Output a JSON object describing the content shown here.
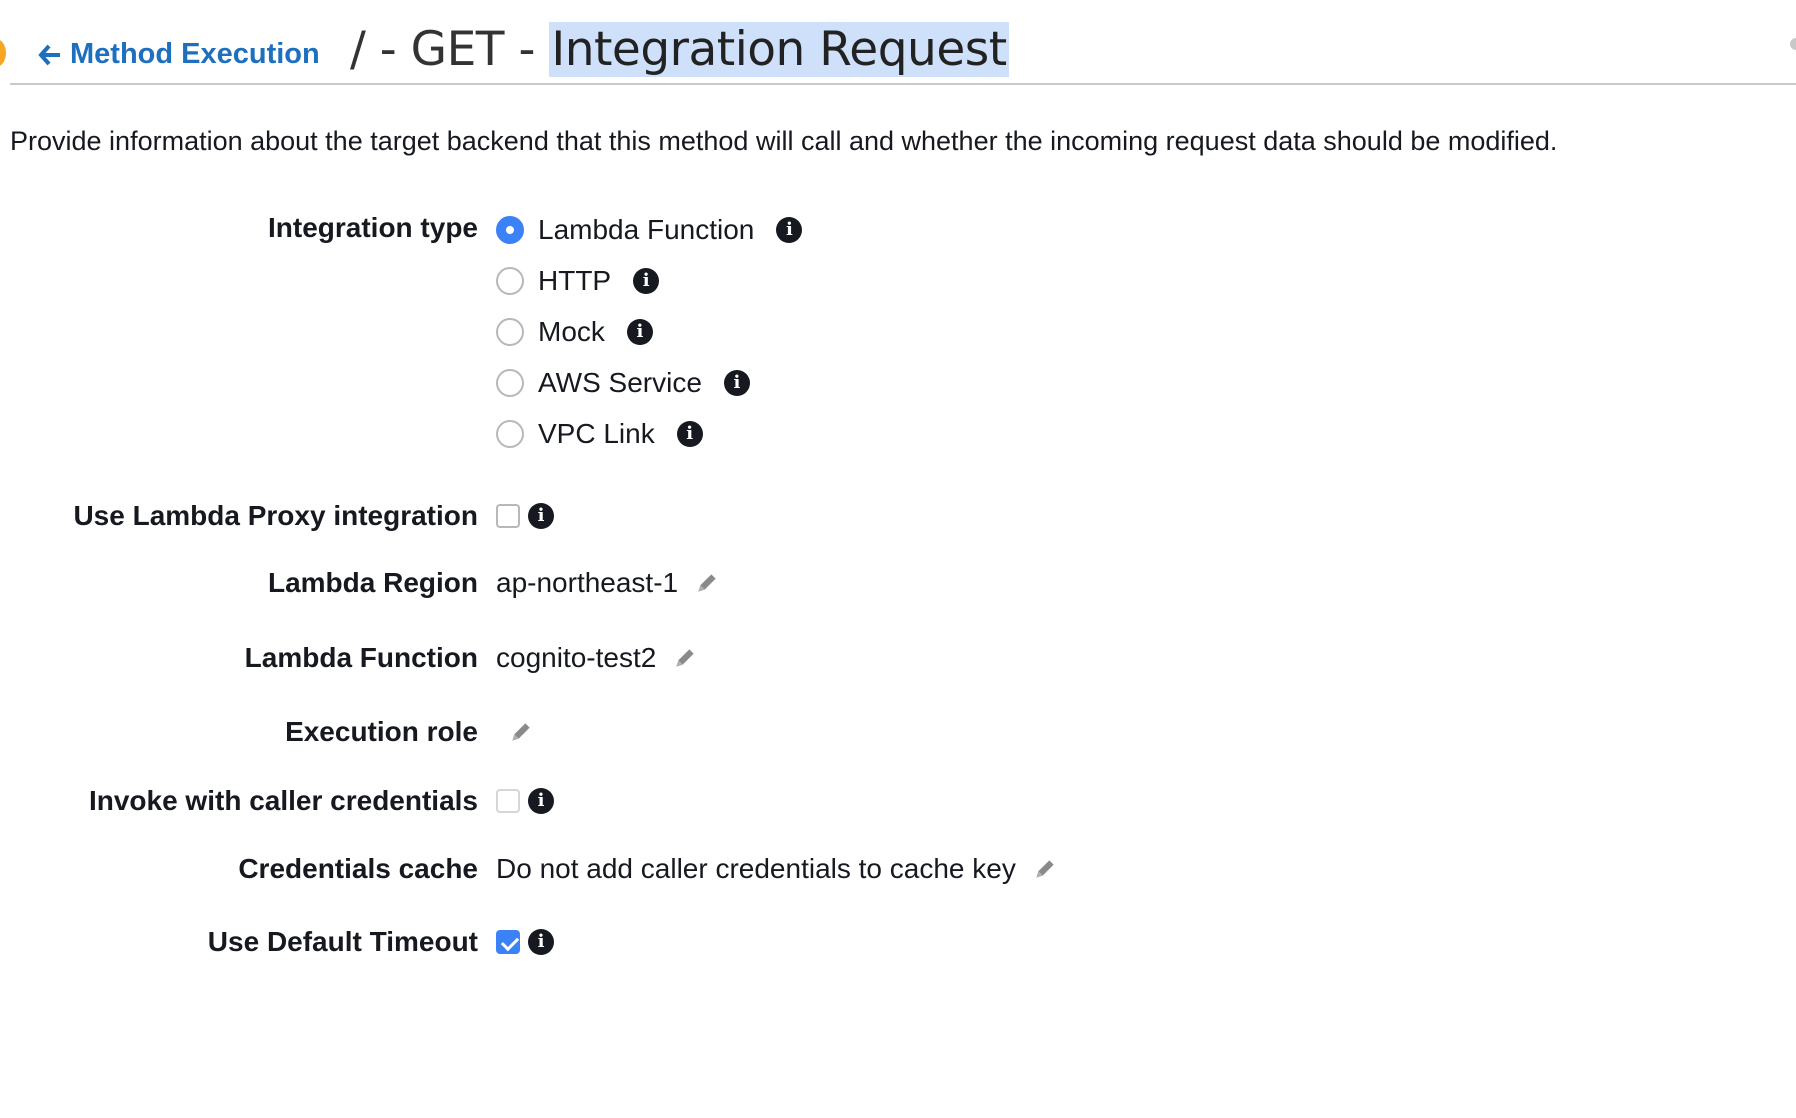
{
  "header": {
    "back_link": "Method Execution",
    "title_prefix": "/ - GET - ",
    "title_highlight": "Integration Request"
  },
  "description": "Provide information about the target backend that this method will call and whether the incoming request data should be modified.",
  "form": {
    "integration_type": {
      "label": "Integration type",
      "options": [
        {
          "label": "Lambda Function",
          "selected": true
        },
        {
          "label": "HTTP",
          "selected": false
        },
        {
          "label": "Mock",
          "selected": false
        },
        {
          "label": "AWS Service",
          "selected": false
        },
        {
          "label": "VPC Link",
          "selected": false
        }
      ]
    },
    "lambda_proxy": {
      "label": "Use Lambda Proxy integration",
      "checked": false
    },
    "lambda_region": {
      "label": "Lambda Region",
      "value": "ap-northeast-1"
    },
    "lambda_function": {
      "label": "Lambda Function",
      "value": "cognito-test2"
    },
    "execution_role": {
      "label": "Execution role",
      "value": ""
    },
    "caller_credentials": {
      "label": "Invoke with caller credentials",
      "checked": false
    },
    "credentials_cache": {
      "label": "Credentials cache",
      "value": "Do not add caller credentials to cache key"
    },
    "default_timeout": {
      "label": "Use Default Timeout",
      "checked": true
    }
  },
  "colors": {
    "link": "#1f6fbf",
    "accent": "#3b82f6",
    "highlight": "#cfe0fa"
  },
  "icons": [
    "arrow-left-icon",
    "info-icon",
    "pencil-icon"
  ]
}
